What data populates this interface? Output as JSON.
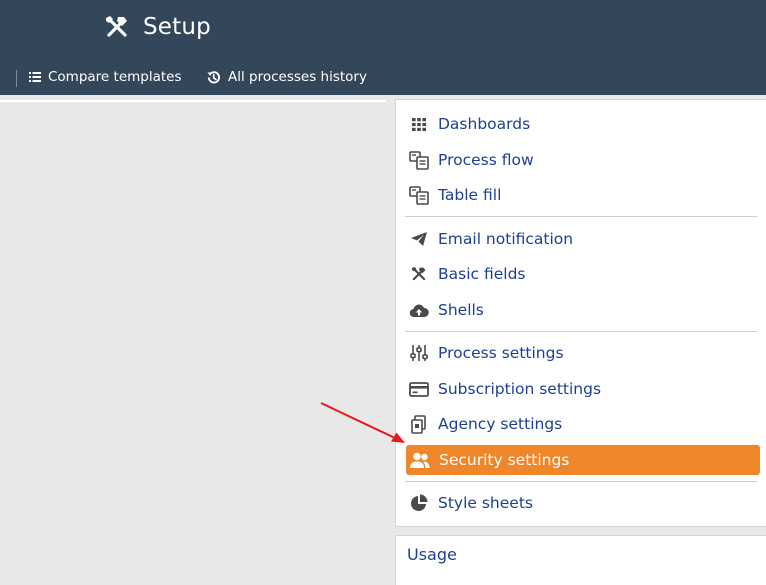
{
  "header": {
    "title": "Setup",
    "icon": "tools-icon",
    "background": "#34475a"
  },
  "toolbar": {
    "compare_label": "Compare templates",
    "history_label": "All processes history"
  },
  "menu": {
    "items": [
      {
        "label": "Dashboards",
        "icon": "grid-icon"
      },
      {
        "label": "Process flow",
        "icon": "flow-icon"
      },
      {
        "label": "Table fill",
        "icon": "table-fill-icon"
      },
      {
        "label": "Email notification",
        "icon": "paper-plane-icon"
      },
      {
        "label": "Basic fields",
        "icon": "tools-icon"
      },
      {
        "label": "Shells",
        "icon": "cloud-upload-icon"
      },
      {
        "label": "Process settings",
        "icon": "sliders-icon"
      },
      {
        "label": "Subscription settings",
        "icon": "credit-card-icon"
      },
      {
        "label": "Agency settings",
        "icon": "agency-icon"
      },
      {
        "label": "Security settings",
        "icon": "users-icon",
        "active": true
      },
      {
        "label": "Style sheets",
        "icon": "pie-chart-icon"
      }
    ],
    "active_color": "#f0862a",
    "link_color": "#1e3f95"
  },
  "usage": {
    "label": "Usage"
  }
}
